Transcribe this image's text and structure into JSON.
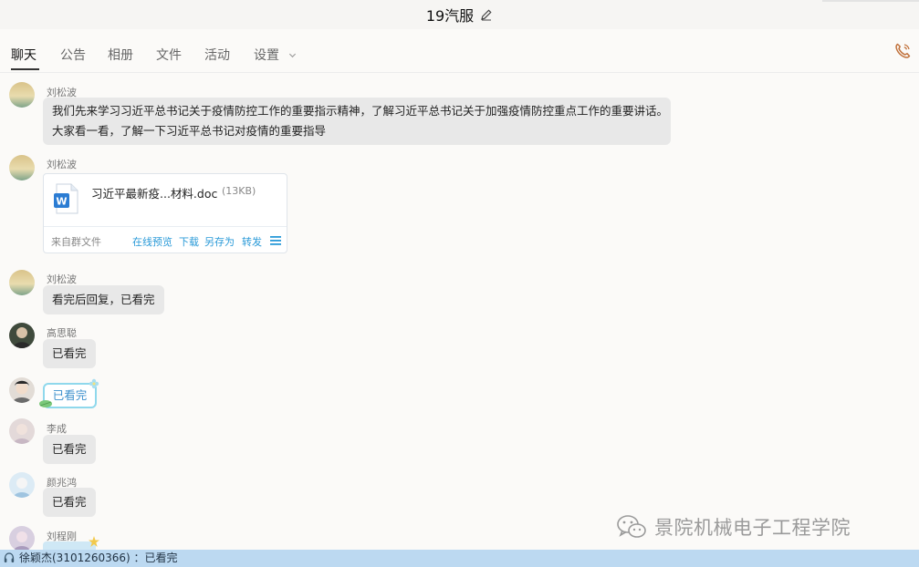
{
  "window": {
    "title": "19汽服"
  },
  "tabs": [
    {
      "label": "聊天",
      "active": true
    },
    {
      "label": "公告"
    },
    {
      "label": "相册"
    },
    {
      "label": "文件"
    },
    {
      "label": "活动"
    },
    {
      "label": "设置"
    }
  ],
  "messages": [
    {
      "sender": "刘松波",
      "lines": [
        "我们先来学习习近平总书记关于疫情防控工作的重要指示精神，了解习近平总书记关于加强疫情防控重点工作的重要讲话。",
        "大家看一看，了解一下习近平总书记对疫情的重要指导"
      ]
    },
    {
      "sender": "刘松波",
      "file": {
        "name": "习近平最新疫...材料.doc",
        "size": "(13KB)",
        "source": "来自群文件",
        "actions": [
          "在线预览",
          "下载",
          "另存为",
          "转发"
        ]
      }
    },
    {
      "sender": "刘松波",
      "text": "看完后回复，已看完"
    },
    {
      "sender": "高思聪",
      "text": "已看完"
    },
    {
      "sender": "",
      "text": "已看完"
    },
    {
      "sender": "李成",
      "text": "已看完"
    },
    {
      "sender": "颜兆鸿",
      "text": "已看完"
    },
    {
      "sender": "刘程刚"
    }
  ],
  "status_bar": {
    "text": "徐颖杰(3101260366) ：已看完"
  },
  "watermark": {
    "text": "景院机械电子工程学院"
  },
  "colors": {
    "accent": "#2a9ad8",
    "status_bar": "#bcd9f1",
    "phone_icon": "#c0703a"
  }
}
